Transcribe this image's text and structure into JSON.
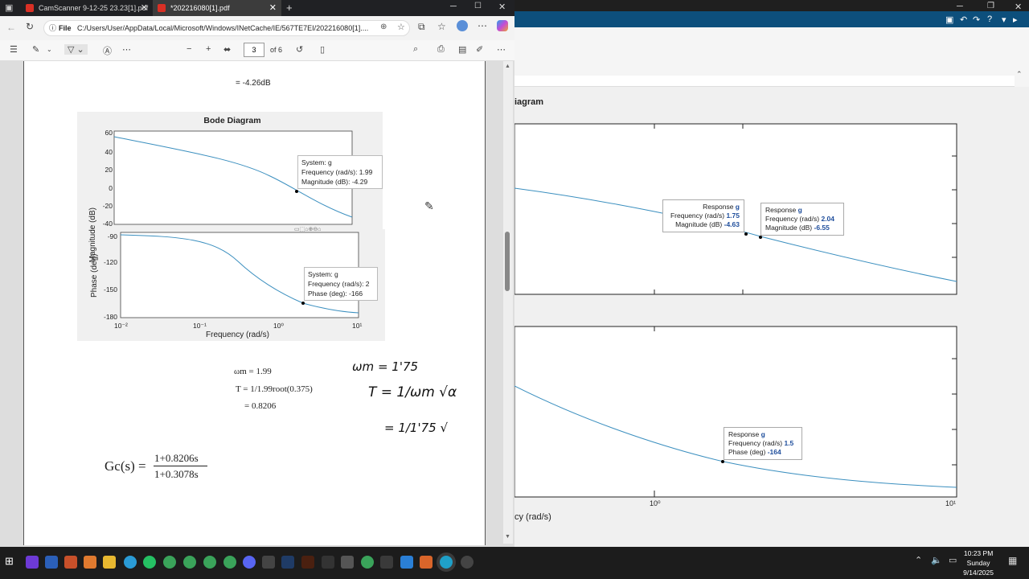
{
  "browser": {
    "tabs": [
      {
        "label": "CamScanner 9-12-25 23.23[1].pdf",
        "active": false
      },
      {
        "label": "*202216080[1].pdf",
        "active": true
      }
    ],
    "address": {
      "scheme_label": "File",
      "url": "C:/Users/User/AppData/Local/Microsoft/Windows/INetCache/IE/567TE7EI/202216080[1]...."
    },
    "pdf_toolbar": {
      "page_number": "3",
      "page_total": "of 6"
    }
  },
  "pdf": {
    "top_value": "= -4.26dB",
    "bode": {
      "title": "Bode Diagram",
      "mag_ylabel": "Magnitude (dB)",
      "phase_ylabel": "Phase (deg)",
      "xlabel": "Frequency  (rad/s)",
      "mag_ticks": [
        "60",
        "40",
        "20",
        "0",
        "-20",
        "-40"
      ],
      "phase_ticks": [
        "-90",
        "-120",
        "-150",
        "-180"
      ],
      "x_ticks": [
        "10⁻²",
        "10⁻¹",
        "10⁰",
        "10¹"
      ],
      "mag_tip": [
        "System: g",
        "Frequency (rad/s): 1.99",
        "Magnitude (dB): -4.29"
      ],
      "phase_tip": [
        "System: g",
        "Frequency (rad/s): 2",
        "Phase (deg): -166"
      ]
    },
    "calc": {
      "line1": "ωm = 1.99",
      "line2": "T = 1/1.99root(0.375)",
      "line3": "= 0.8206",
      "gc_lhs": "Gc(s) =",
      "gc_num": "1+0.8206s",
      "gc_den": "1+0.3078s"
    },
    "handwriting": {
      "l1": "ωm = 1'75",
      "l2": "T = 1/ωm √α",
      "l3": "= 1/1'75 √"
    }
  },
  "matlab": {
    "title_partial": "iagram",
    "xlabel_partial": "cy (rad/s)",
    "x_ticks": [
      "10⁰",
      "10¹"
    ],
    "tip1": {
      "t": "Response",
      "v": "g",
      "f_l": "Frequency  (rad/s)",
      "f_v": "1.75",
      "m_l": "Magnitude  (dB)",
      "m_v": "-4.63"
    },
    "tip2": {
      "t": "Response",
      "v": "g",
      "f_l": "Frequency  (rad/s)",
      "f_v": "2.04",
      "m_l": "Magnitude  (dB)",
      "m_v": "-6.55"
    },
    "tip3": {
      "t": "Response",
      "v": "g",
      "f_l": "Frequency  (rad/s)",
      "f_v": "1.5",
      "m_l": "Phase  (deg)",
      "m_v": "-164"
    }
  },
  "taskbar": {
    "time": "10:23 PM",
    "day": "Sunday",
    "date": "9/14/2025"
  },
  "colors": {
    "curve": "#3b8fbf",
    "accent": "#0d4f7c"
  }
}
